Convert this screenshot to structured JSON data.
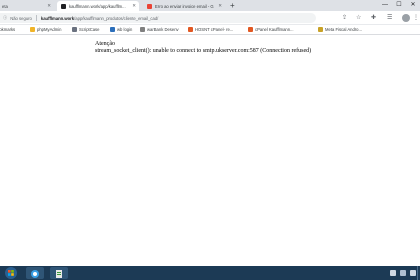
{
  "browser": {
    "tabs": [
      {
        "label": "eta",
        "active": false
      },
      {
        "label": "kaufflmann.work/app/kaufflm...",
        "active": true
      },
      {
        "label": "Erro ao enviar invoice email - G",
        "active": false
      }
    ],
    "address": {
      "security_label": "Não seguro",
      "url_host": "kaufflmann.work",
      "url_path": "/app/kaufflmann_produtos/cliente_email_cad/"
    },
    "bookmarks": [
      {
        "label": "ookmarks",
        "icon": "apps-icon",
        "color": "#5f6368"
      },
      {
        "label": "phpMyAdmin",
        "icon": "phpmyadmin-icon",
        "color": "#f0b429"
      },
      {
        "label": "ScriptCase",
        "icon": "scriptcase-icon",
        "color": "#6b7280"
      },
      {
        "label": "wb login",
        "icon": "wb-icon",
        "color": "#2c6fbb"
      },
      {
        "label": "warBank Desenv",
        "icon": "bookmark-icon",
        "color": "#808080"
      },
      {
        "label": "HOSNT cPanel- re...",
        "icon": "cpanel-icon",
        "color": "#e25822"
      },
      {
        "label": "cPanel Kaufflmann...",
        "icon": "cpanel-icon",
        "color": "#e25822"
      },
      {
        "label": "Meta Fiscal Andro...",
        "icon": "folder-icon",
        "color": "#c9a227"
      }
    ]
  },
  "page": {
    "title": "Atenção",
    "message": "stream_socket_client(): unable to connect to smtp.ukserver.com:587 (Connection refused)"
  },
  "colors": {
    "taskbar": "#1c3a55",
    "tab_strip": "#dee1e6",
    "accent": "#1a73e8"
  }
}
